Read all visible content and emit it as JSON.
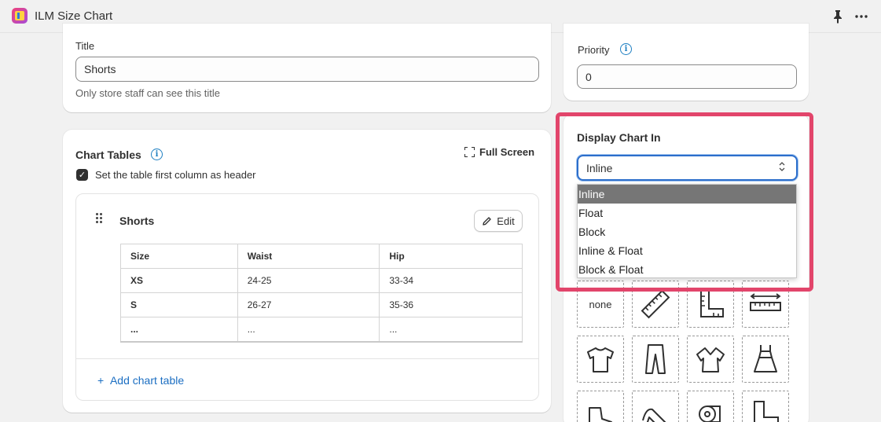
{
  "app": {
    "title": "ILM Size Chart"
  },
  "title_section": {
    "label": "Title",
    "value": "Shorts",
    "help": "Only store staff can see this title"
  },
  "priority": {
    "label": "Priority",
    "value": "0"
  },
  "chart_tables": {
    "heading": "Chart Tables",
    "full_screen": "Full Screen",
    "checkbox_label": "Set the table first column as header",
    "checkbox_checked": true,
    "table": {
      "name": "Shorts",
      "edit_label": "Edit",
      "headers": [
        "Size",
        "Waist",
        "Hip"
      ],
      "rows": [
        [
          "XS",
          "24-25",
          "33-34"
        ],
        [
          "S",
          "26-27",
          "35-36"
        ],
        [
          "...",
          "...",
          "..."
        ]
      ]
    },
    "add_label": "Add chart table",
    "add_prefix": "+"
  },
  "display_chart": {
    "heading": "Display Chart In",
    "selected": "Inline",
    "options": [
      "Inline",
      "Float",
      "Block",
      "Inline & Float",
      "Block & Float"
    ],
    "none_label": "none"
  },
  "colors": {
    "highlight": "#e2456b",
    "link": "#1b6ec2",
    "focus": "#2c6ecb"
  }
}
